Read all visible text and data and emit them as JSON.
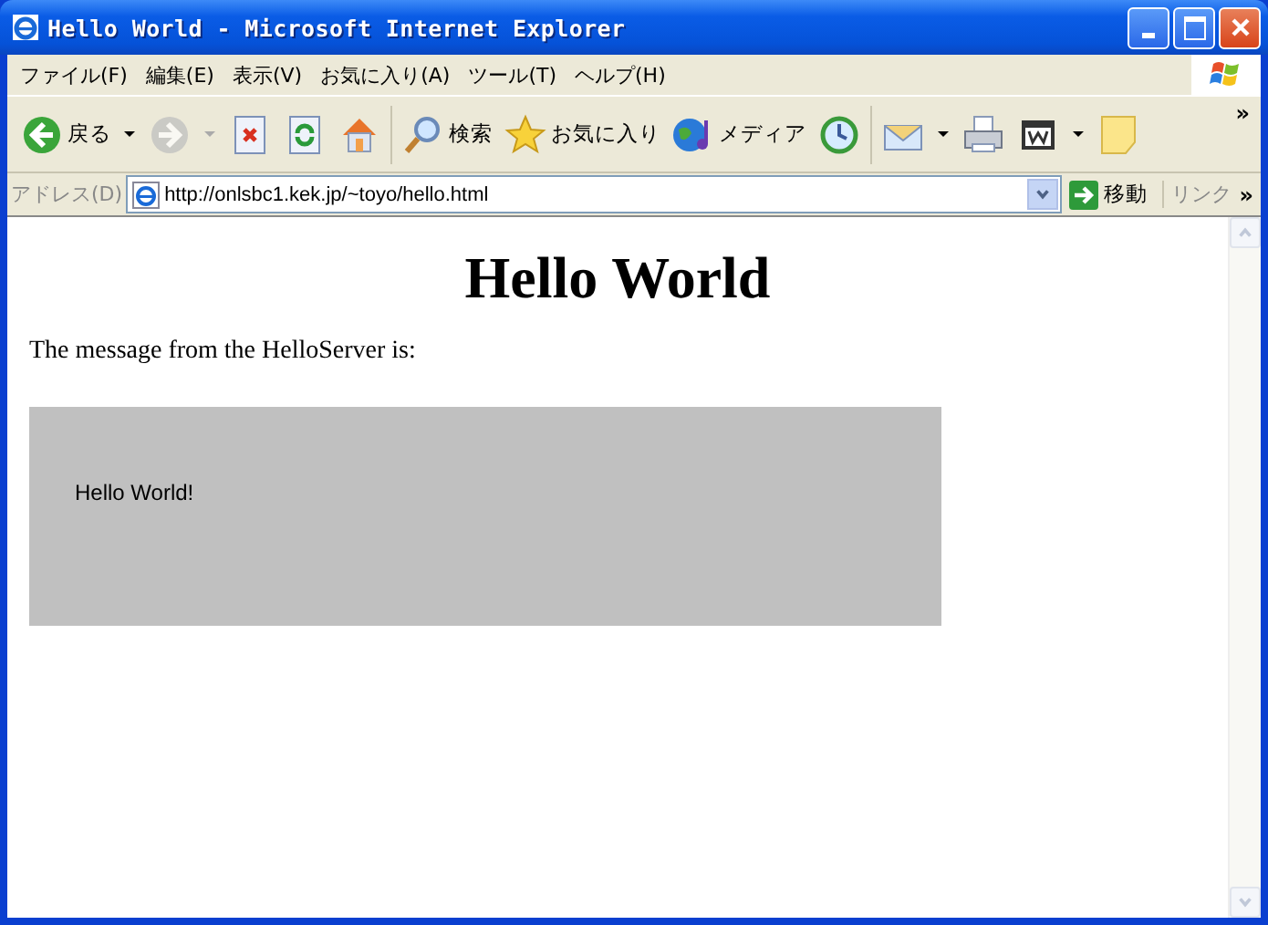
{
  "window": {
    "title": "Hello World - Microsoft Internet Explorer"
  },
  "menu": [
    "ファイル(F)",
    "編集(E)",
    "表示(V)",
    "お気に入り(A)",
    "ツール(T)",
    "ヘルプ(H)"
  ],
  "toolbar": [
    {
      "kind": "back",
      "label": "戻る",
      "dropdown": true,
      "disabled": false
    },
    {
      "kind": "forward",
      "dropdown": true,
      "disabled": true
    },
    {
      "kind": "stop",
      "dropdown": false,
      "disabled": false
    },
    {
      "kind": "refresh",
      "dropdown": false,
      "disabled": false
    },
    {
      "kind": "home",
      "dropdown": false,
      "disabled": false
    },
    {
      "kind": "search",
      "label": "検索",
      "dropdown": false,
      "disabled": false
    },
    {
      "kind": "favorites",
      "label": "お気に入り",
      "dropdown": false,
      "disabled": false
    },
    {
      "kind": "media",
      "label": "メディア",
      "dropdown": false,
      "disabled": false
    },
    {
      "kind": "history",
      "dropdown": false,
      "disabled": false
    },
    {
      "kind": "mail",
      "dropdown": true,
      "disabled": false
    },
    {
      "kind": "print",
      "dropdown": false,
      "disabled": false
    },
    {
      "kind": "edit",
      "dropdown": true,
      "disabled": false
    },
    {
      "kind": "note",
      "dropdown": false,
      "disabled": false
    }
  ],
  "toolbar_more": "»",
  "address_bar": {
    "label": "アドレス(D)",
    "url": "http://onlsbc1.kek.jp/~toyo/hello.html",
    "go": "移動",
    "links": "リンク",
    "links_more": "»"
  },
  "page": {
    "heading": "Hello World",
    "paragraph": "The message from the HelloServer is:",
    "applet_text": "Hello World!"
  }
}
